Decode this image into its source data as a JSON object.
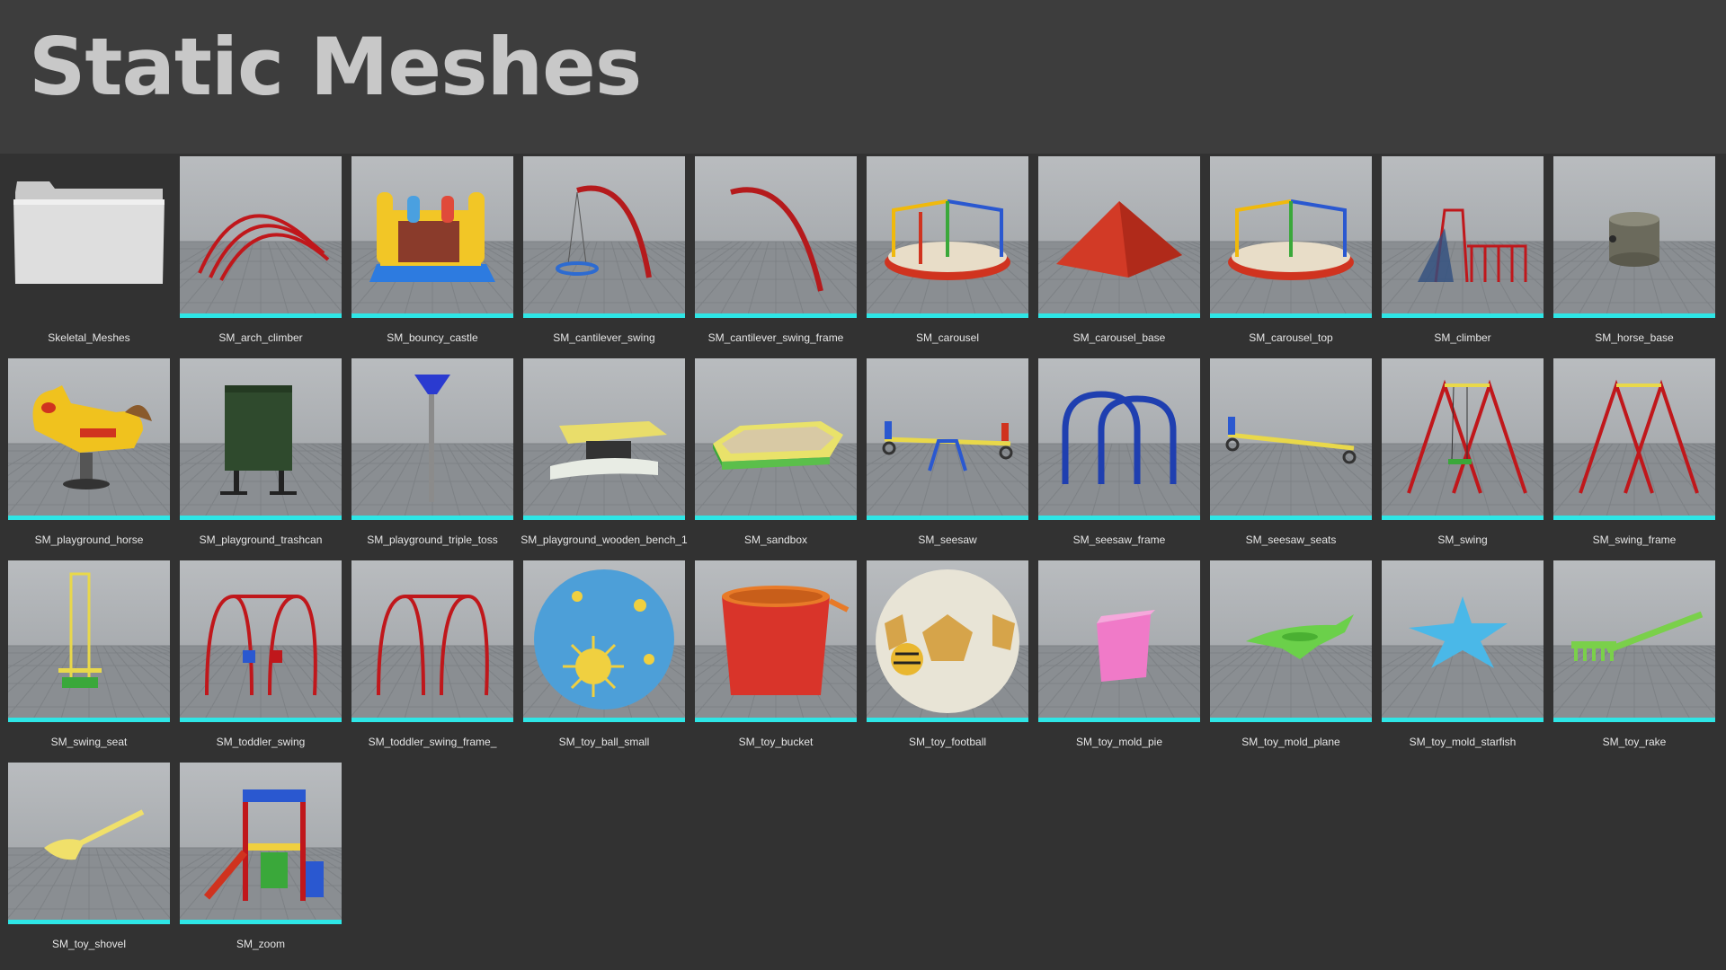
{
  "page": {
    "title": "Static Meshes"
  },
  "items": [
    {
      "label": "Skeletal_Meshes",
      "icon": "folder-icon",
      "type": "folder"
    },
    {
      "label": "SM_arch_climber",
      "icon": "arch-climber-icon"
    },
    {
      "label": "SM_bouncy_castle",
      "icon": "bouncy-castle-icon"
    },
    {
      "label": "SM_cantilever_swing",
      "icon": "cantilever-swing-icon"
    },
    {
      "label": "SM_cantilever_swing_frame",
      "icon": "cantilever-frame-icon"
    },
    {
      "label": "SM_carousel",
      "icon": "carousel-icon"
    },
    {
      "label": "SM_carousel_base",
      "icon": "carousel-base-icon"
    },
    {
      "label": "SM_carousel_top",
      "icon": "carousel-top-icon"
    },
    {
      "label": "SM_climber",
      "icon": "climber-icon"
    },
    {
      "label": "SM_horse_base",
      "icon": "horse-base-icon"
    },
    {
      "label": "SM_playground_horse",
      "icon": "rocking-horse-icon"
    },
    {
      "label": "SM_playground_trashcan",
      "icon": "trashcan-icon"
    },
    {
      "label": "SM_playground_triple_toss",
      "icon": "triple-toss-icon"
    },
    {
      "label": "SM_playground_wooden_bench_1",
      "icon": "bench-icon"
    },
    {
      "label": "SM_sandbox",
      "icon": "sandbox-icon"
    },
    {
      "label": "SM_seesaw",
      "icon": "seesaw-icon"
    },
    {
      "label": "SM_seesaw_frame",
      "icon": "seesaw-frame-icon"
    },
    {
      "label": "SM_seesaw_seats",
      "icon": "seesaw-seats-icon"
    },
    {
      "label": "SM_swing",
      "icon": "swing-icon"
    },
    {
      "label": "SM_swing_frame",
      "icon": "swing-frame-icon"
    },
    {
      "label": "SM_swing_seat",
      "icon": "swing-seat-icon"
    },
    {
      "label": "SM_toddler_swing",
      "icon": "toddler-swing-icon"
    },
    {
      "label": "SM_toddler_swing_frame_",
      "icon": "toddler-swing-frame-icon"
    },
    {
      "label": "SM_toy_ball_small",
      "icon": "ball-icon"
    },
    {
      "label": "SM_toy_bucket",
      "icon": "bucket-icon"
    },
    {
      "label": "SM_toy_football",
      "icon": "football-icon"
    },
    {
      "label": "SM_toy_mold_pie",
      "icon": "mold-pie-icon"
    },
    {
      "label": "SM_toy_mold_plane",
      "icon": "mold-plane-icon"
    },
    {
      "label": "SM_toy_mold_starfish",
      "icon": "mold-starfish-icon"
    },
    {
      "label": "SM_toy_rake",
      "icon": "rake-icon"
    },
    {
      "label": "SM_toy_shovel",
      "icon": "shovel-icon"
    },
    {
      "label": "SM_zoom",
      "icon": "play-tower-icon"
    }
  ],
  "colors": {
    "accent_bar": "#2ee6e6",
    "background": "#3d3d3d",
    "panel": "#323232",
    "title": "#c8c8c8"
  }
}
